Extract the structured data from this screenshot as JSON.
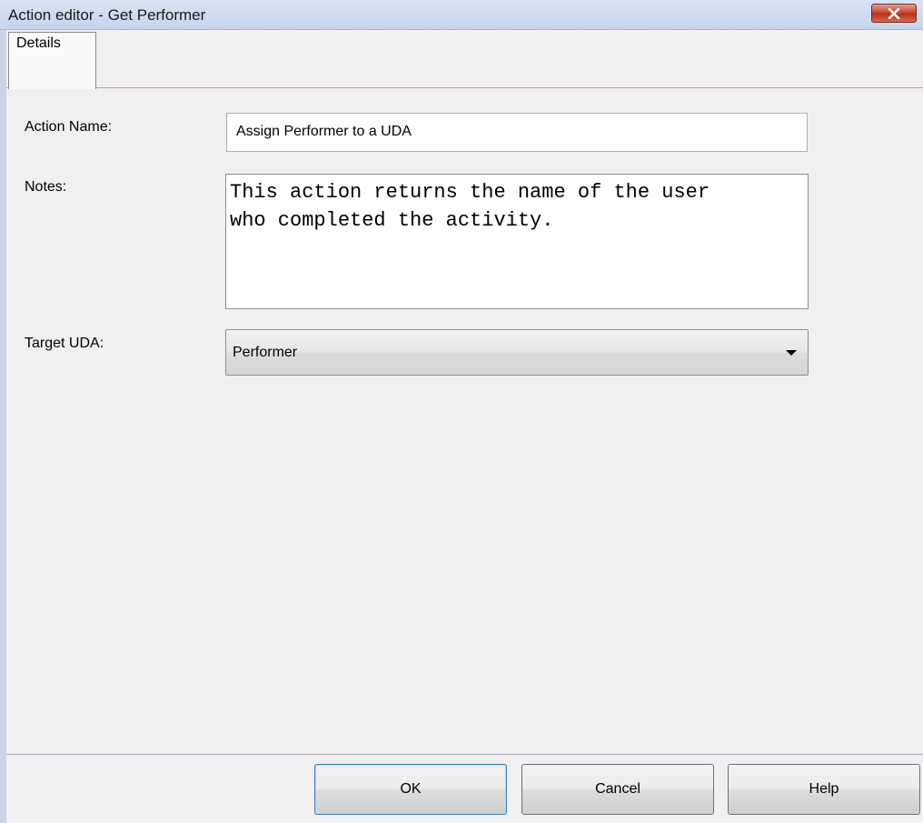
{
  "window": {
    "title": "Action editor - Get Performer",
    "close_icon": "close-icon"
  },
  "tabs": [
    {
      "label": "Details",
      "selected": true
    }
  ],
  "form": {
    "action_name": {
      "label": "Action Name:",
      "value": "Assign Performer to a UDA"
    },
    "notes": {
      "label": "Notes:",
      "value": "This action returns the name of the user\nwho completed the activity."
    },
    "target_uda": {
      "label": "Target UDA:",
      "value": "Performer",
      "icon": "chevron-down-icon"
    }
  },
  "buttons": {
    "ok": "OK",
    "cancel": "Cancel",
    "help": "Help"
  },
  "colors": {
    "close_button": "#c7432a",
    "titlebar": "#c6d5ec",
    "client": "#f2eff2",
    "default_button_border": "#3c7fb1"
  }
}
